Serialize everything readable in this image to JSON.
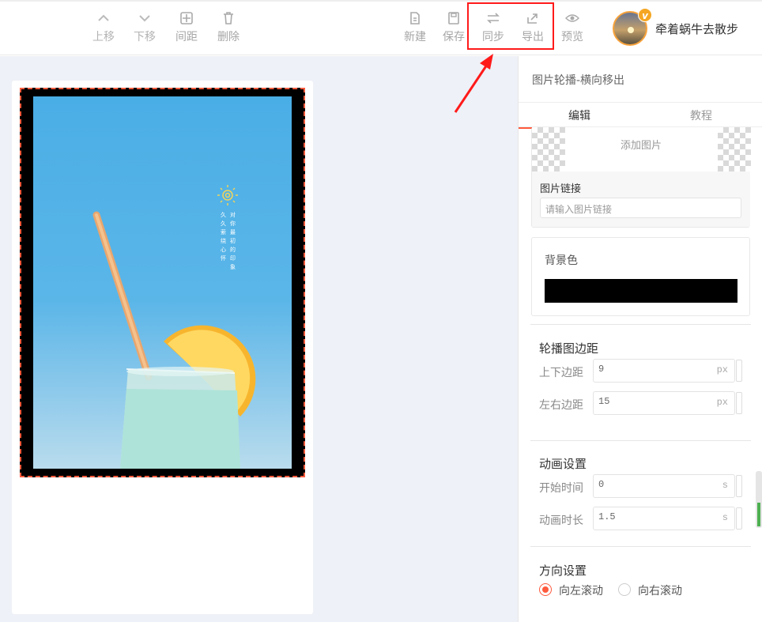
{
  "toolbar": {
    "move_up": "上移",
    "move_down": "下移",
    "spacing": "间距",
    "delete": "删除",
    "new": "新建",
    "save": "保存",
    "sync": "同步",
    "export": "导出",
    "preview": "预览"
  },
  "user": {
    "name": "牵着蜗牛去散步",
    "badge": "v"
  },
  "slide_text": {
    "col1": "久久萦绕心怀",
    "col2": "对你最初的印象"
  },
  "panel": {
    "title": "图片轮播-横向移出",
    "tabs": [
      "编辑",
      "教程"
    ],
    "add_image": "添加图片",
    "image_link_label": "图片链接",
    "image_link_placeholder": "请输入图片链接",
    "bg_color_label": "背景色",
    "bg_color": "#000000",
    "margin_section": "轮播图边距",
    "margin_tb_label": "上下边距",
    "margin_tb_value": "9",
    "margin_lr_label": "左右边距",
    "margin_lr_value": "15",
    "px_unit": "px",
    "anim_section": "动画设置",
    "start_label": "开始时间",
    "start_value": "0",
    "duration_label": "动画时长",
    "duration_value": "1.5",
    "s_unit": "s",
    "dir_section": "方向设置",
    "dir_left": "向左滚动",
    "dir_right": "向右滚动"
  },
  "colors": {
    "accent": "#ff5a3c",
    "highlight": "#ff1a1a",
    "canvas_bg": "#eef1f7"
  }
}
